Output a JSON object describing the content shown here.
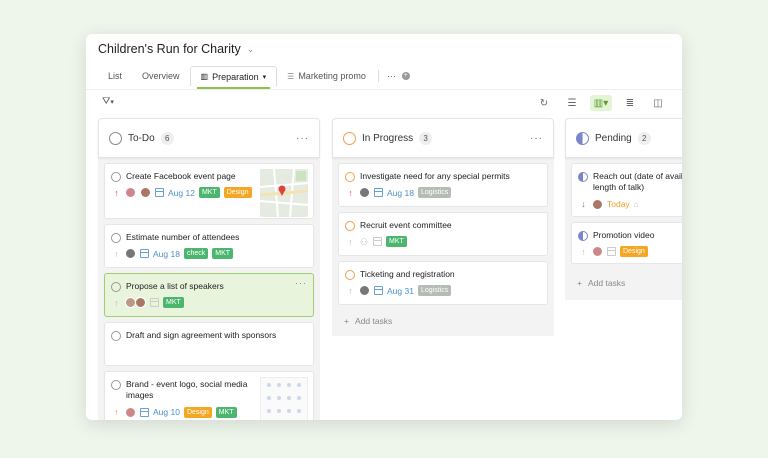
{
  "project": {
    "title": "Children's Run for Charity"
  },
  "tabs": [
    {
      "label": "List"
    },
    {
      "label": "Overview"
    },
    {
      "label": "Preparation"
    },
    {
      "label": "Marketing promo"
    },
    {
      "label": "···"
    }
  ],
  "tag_colors": {
    "MKT": "#4cb66e",
    "Design": "#f5a623",
    "check": "#4cb66e",
    "Logistics": "#b5bcb5"
  },
  "columns": [
    {
      "name": "To-Do",
      "count": "6",
      "more": "···",
      "cards": [
        {
          "title": "Create Facebook event page",
          "date": "Aug 12",
          "tags": [
            "MKT",
            "Design"
          ]
        },
        {
          "title": "Estimate number of attendees",
          "date": "Aug 18",
          "tags": [
            "check",
            "MKT"
          ]
        },
        {
          "title": "Propose a list of speakers",
          "tags": [
            "MKT"
          ],
          "more": "···"
        },
        {
          "title": "Draft and sign agreement with sponsors"
        },
        {
          "title": "Brand - event logo, social media images",
          "date": "Aug 10",
          "tags": [
            "Design",
            "MKT"
          ]
        }
      ]
    },
    {
      "name": "In Progress",
      "count": "3",
      "more": "···",
      "cards": [
        {
          "title": "Investigate need for any special permits",
          "date": "Aug 18",
          "tags": [
            "Logistics"
          ]
        },
        {
          "title": "Recruit event committee",
          "tags": [
            "MKT"
          ]
        },
        {
          "title": "Ticketing and registration",
          "date": "Aug 31",
          "tags": [
            "Logistics"
          ]
        }
      ],
      "add": "Add tasks"
    },
    {
      "name": "Pending",
      "count": "2",
      "cards": [
        {
          "title": "Reach out (date of availa & length of talk)",
          "date": "Today"
        },
        {
          "title": "Promotion video",
          "tags": [
            "Design"
          ]
        }
      ],
      "add": "Add tasks"
    }
  ]
}
